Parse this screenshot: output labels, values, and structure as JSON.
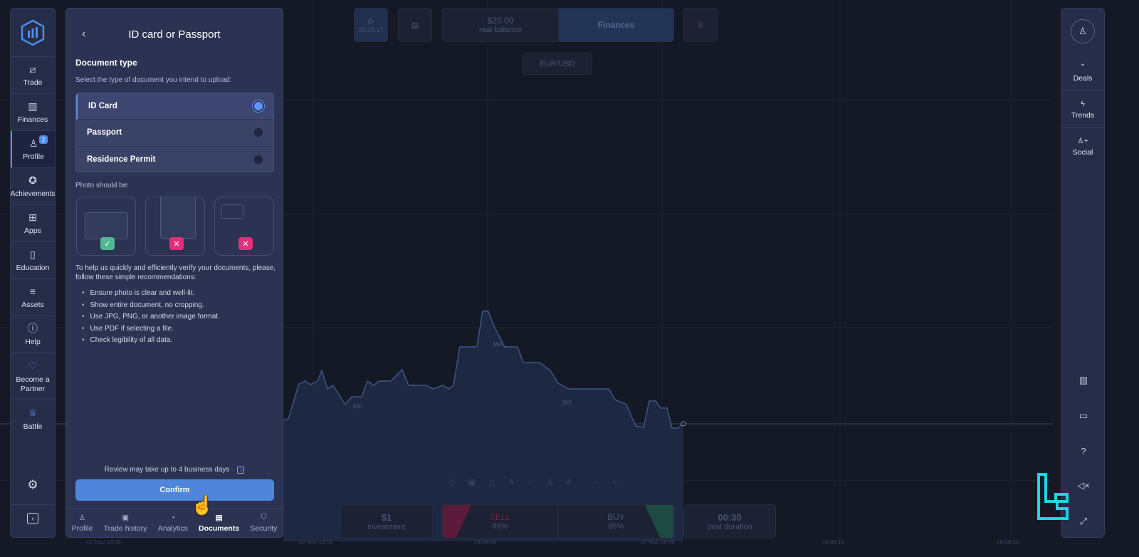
{
  "left_nav": {
    "items": [
      {
        "label": "Trade",
        "icon": "chart-icon"
      },
      {
        "label": "Finances",
        "icon": "finances-icon"
      },
      {
        "label": "Profile",
        "icon": "user-icon",
        "badge": "2",
        "active": true
      },
      {
        "label": "Achievements",
        "icon": "medal-icon"
      },
      {
        "label": "Apps",
        "icon": "apps-icon"
      },
      {
        "label": "Education",
        "icon": "book-icon"
      },
      {
        "label": "Assets",
        "icon": "assets-icon"
      },
      {
        "label": "Help",
        "icon": "info-icon"
      },
      {
        "label": "Become a Partner",
        "icon": "heart-icon"
      },
      {
        "label": "Battle",
        "icon": "trophy-icon"
      }
    ]
  },
  "panel": {
    "title": "ID card or Passport",
    "doc_type_heading": "Document type",
    "doc_type_sub": "Select the type of document you intend to upload:",
    "options": [
      {
        "label": "ID Card",
        "selected": true
      },
      {
        "label": "Passport",
        "selected": false
      },
      {
        "label": "Residence Permit",
        "selected": false
      }
    ],
    "photo_heading": "Photo should be:",
    "intro": "To help us quickly and efficiently verify your documents, please, follow these simple recommendations:",
    "tips": [
      "Ensure photo is clear and well-lit.",
      "Show entire document, no cropping.",
      "Use JPG, PNG, or another image format.",
      "Use PDF if selecting a file.",
      "Check legibility of all data."
    ],
    "review_note": "Review may take up to 4 business days",
    "confirm_label": "Confirm",
    "tabs": [
      {
        "label": "Profile"
      },
      {
        "label": "Trade history"
      },
      {
        "label": "Analytics"
      },
      {
        "label": "Documents",
        "active": true
      },
      {
        "label": "Security"
      }
    ]
  },
  "header": {
    "timer": "23:25:17",
    "balance": "$20.00",
    "balance_label": "real balance",
    "finances_label": "Finances",
    "asset": "EUR/USD"
  },
  "chart": {
    "markers": [
      "$40",
      "$50",
      "$65"
    ],
    "time_labels": [
      "02 Nov 18:05",
      "18:05:45",
      "07 Nov 18:06",
      "18:06:15",
      "18:06:30"
    ]
  },
  "trade": {
    "investment": "$1",
    "investment_label": "investment",
    "sell_label": "SELL",
    "sell_pct": "85%",
    "buy_label": "BUY",
    "buy_pct": "85%",
    "duration": "00:30",
    "duration_label": "deal duration"
  },
  "right_nav": {
    "items": [
      {
        "label": "Deals"
      },
      {
        "label": "Trends"
      },
      {
        "label": "Social"
      }
    ]
  },
  "colors": {
    "accent": "#4f86dc",
    "success": "#4fb893",
    "danger": "#e0307a",
    "panel": "#2c3352"
  }
}
